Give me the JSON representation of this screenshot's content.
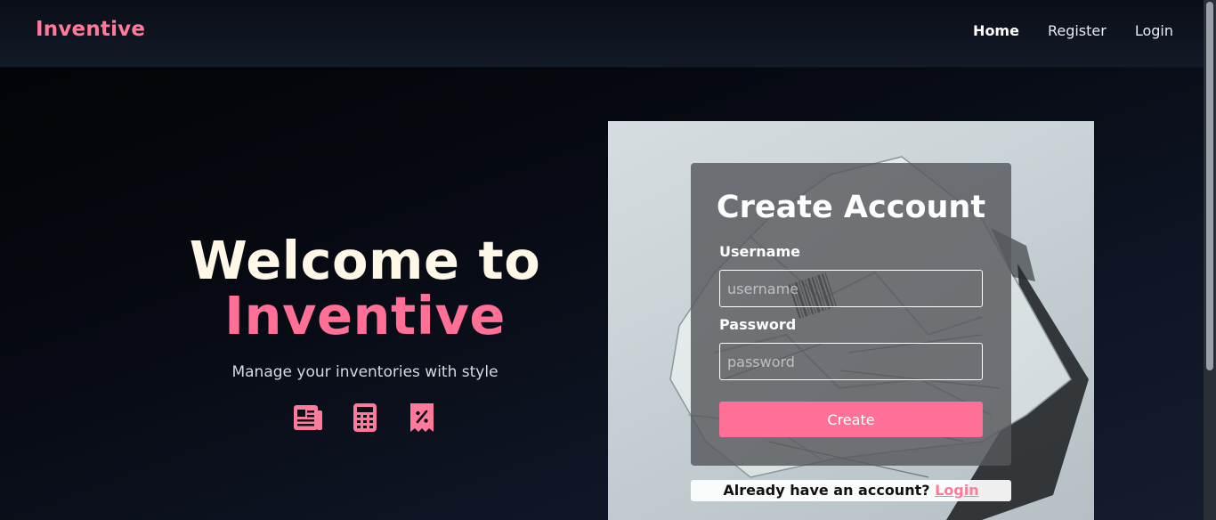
{
  "brand": {
    "name": "Inventive",
    "color": "#ff7a9a"
  },
  "nav": {
    "items": [
      {
        "label": "Home",
        "active": true
      },
      {
        "label": "Register",
        "active": false
      },
      {
        "label": "Login",
        "active": false
      }
    ]
  },
  "hero": {
    "title_line1": "Welcome to",
    "title_line2": "Inventive",
    "subtitle": "Manage your inventories with style",
    "icons": [
      "newspaper-icon",
      "calculator-icon",
      "receipt-percent-icon"
    ],
    "accent_color": "#ff6f96"
  },
  "form": {
    "title": "Create Account",
    "username_label": "Username",
    "username_placeholder": "username",
    "username_value": "",
    "password_label": "Password",
    "password_placeholder": "password",
    "password_value": "",
    "submit_label": "Create"
  },
  "login_hint": {
    "text": "Already have an account?",
    "link_label": "Login"
  }
}
